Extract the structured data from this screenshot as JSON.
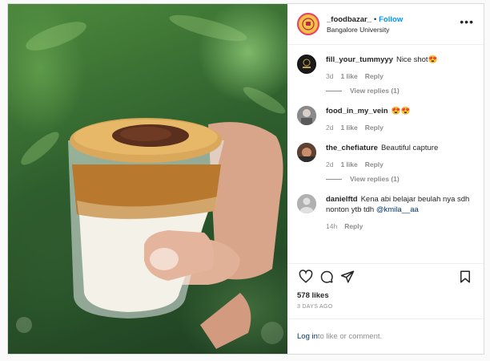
{
  "header": {
    "username": "_foodbazar_",
    "dot": "•",
    "follow_label": "Follow",
    "location": "Bangalore University",
    "more_label": "•••"
  },
  "comments": [
    {
      "user": "fill_your_tummyyy",
      "text": "Nice shot😍",
      "time": "3d",
      "likes": "1 like",
      "reply": "Reply",
      "view_replies": "View replies (1)"
    },
    {
      "user": "food_in_my_vein",
      "text": "😍😍",
      "time": "2d",
      "likes": "1 like",
      "reply": "Reply"
    },
    {
      "user": "the_chefiature",
      "text": "Beautiful capture",
      "time": "2d",
      "likes": "1 like",
      "reply": "Reply",
      "view_replies": "View replies (1)"
    },
    {
      "user": "danielftd",
      "text": "Kena abi belajar beulah nya sdh nonton ytb tdh ",
      "mention": "@kmila__aa",
      "time": "14h",
      "reply": "Reply"
    }
  ],
  "stats": {
    "likes": "578 likes",
    "age": "3 DAYS AGO"
  },
  "login": {
    "link": "Log in",
    "rest": " to like or comment."
  },
  "icons": {
    "like": "heart-icon",
    "comment": "comment-bubble-icon",
    "share": "paper-plane-icon",
    "save": "bookmark-icon",
    "more": "ellipsis-icon"
  },
  "colors": {
    "follow": "#0095f6",
    "avatar_ring": "#e6406d",
    "muted": "#8e8e8e"
  }
}
